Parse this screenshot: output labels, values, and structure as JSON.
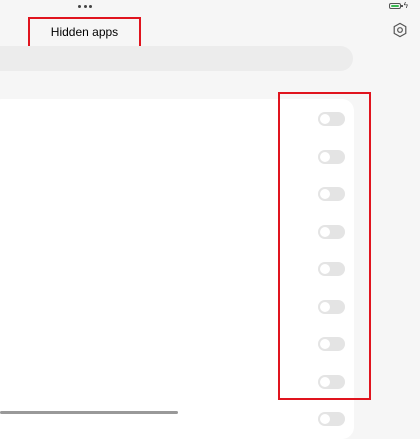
{
  "header": {
    "title": "Hidden apps",
    "settings_icon": "gear-icon"
  },
  "status_bar": {
    "battery_icon": "battery-icon",
    "battery_color": "#3cba54"
  },
  "accent_color": "#e0141e",
  "toggles": [
    {
      "state": "off"
    },
    {
      "state": "off"
    },
    {
      "state": "off"
    },
    {
      "state": "off"
    },
    {
      "state": "off"
    },
    {
      "state": "off"
    },
    {
      "state": "off"
    },
    {
      "state": "off"
    },
    {
      "state": "off"
    }
  ]
}
